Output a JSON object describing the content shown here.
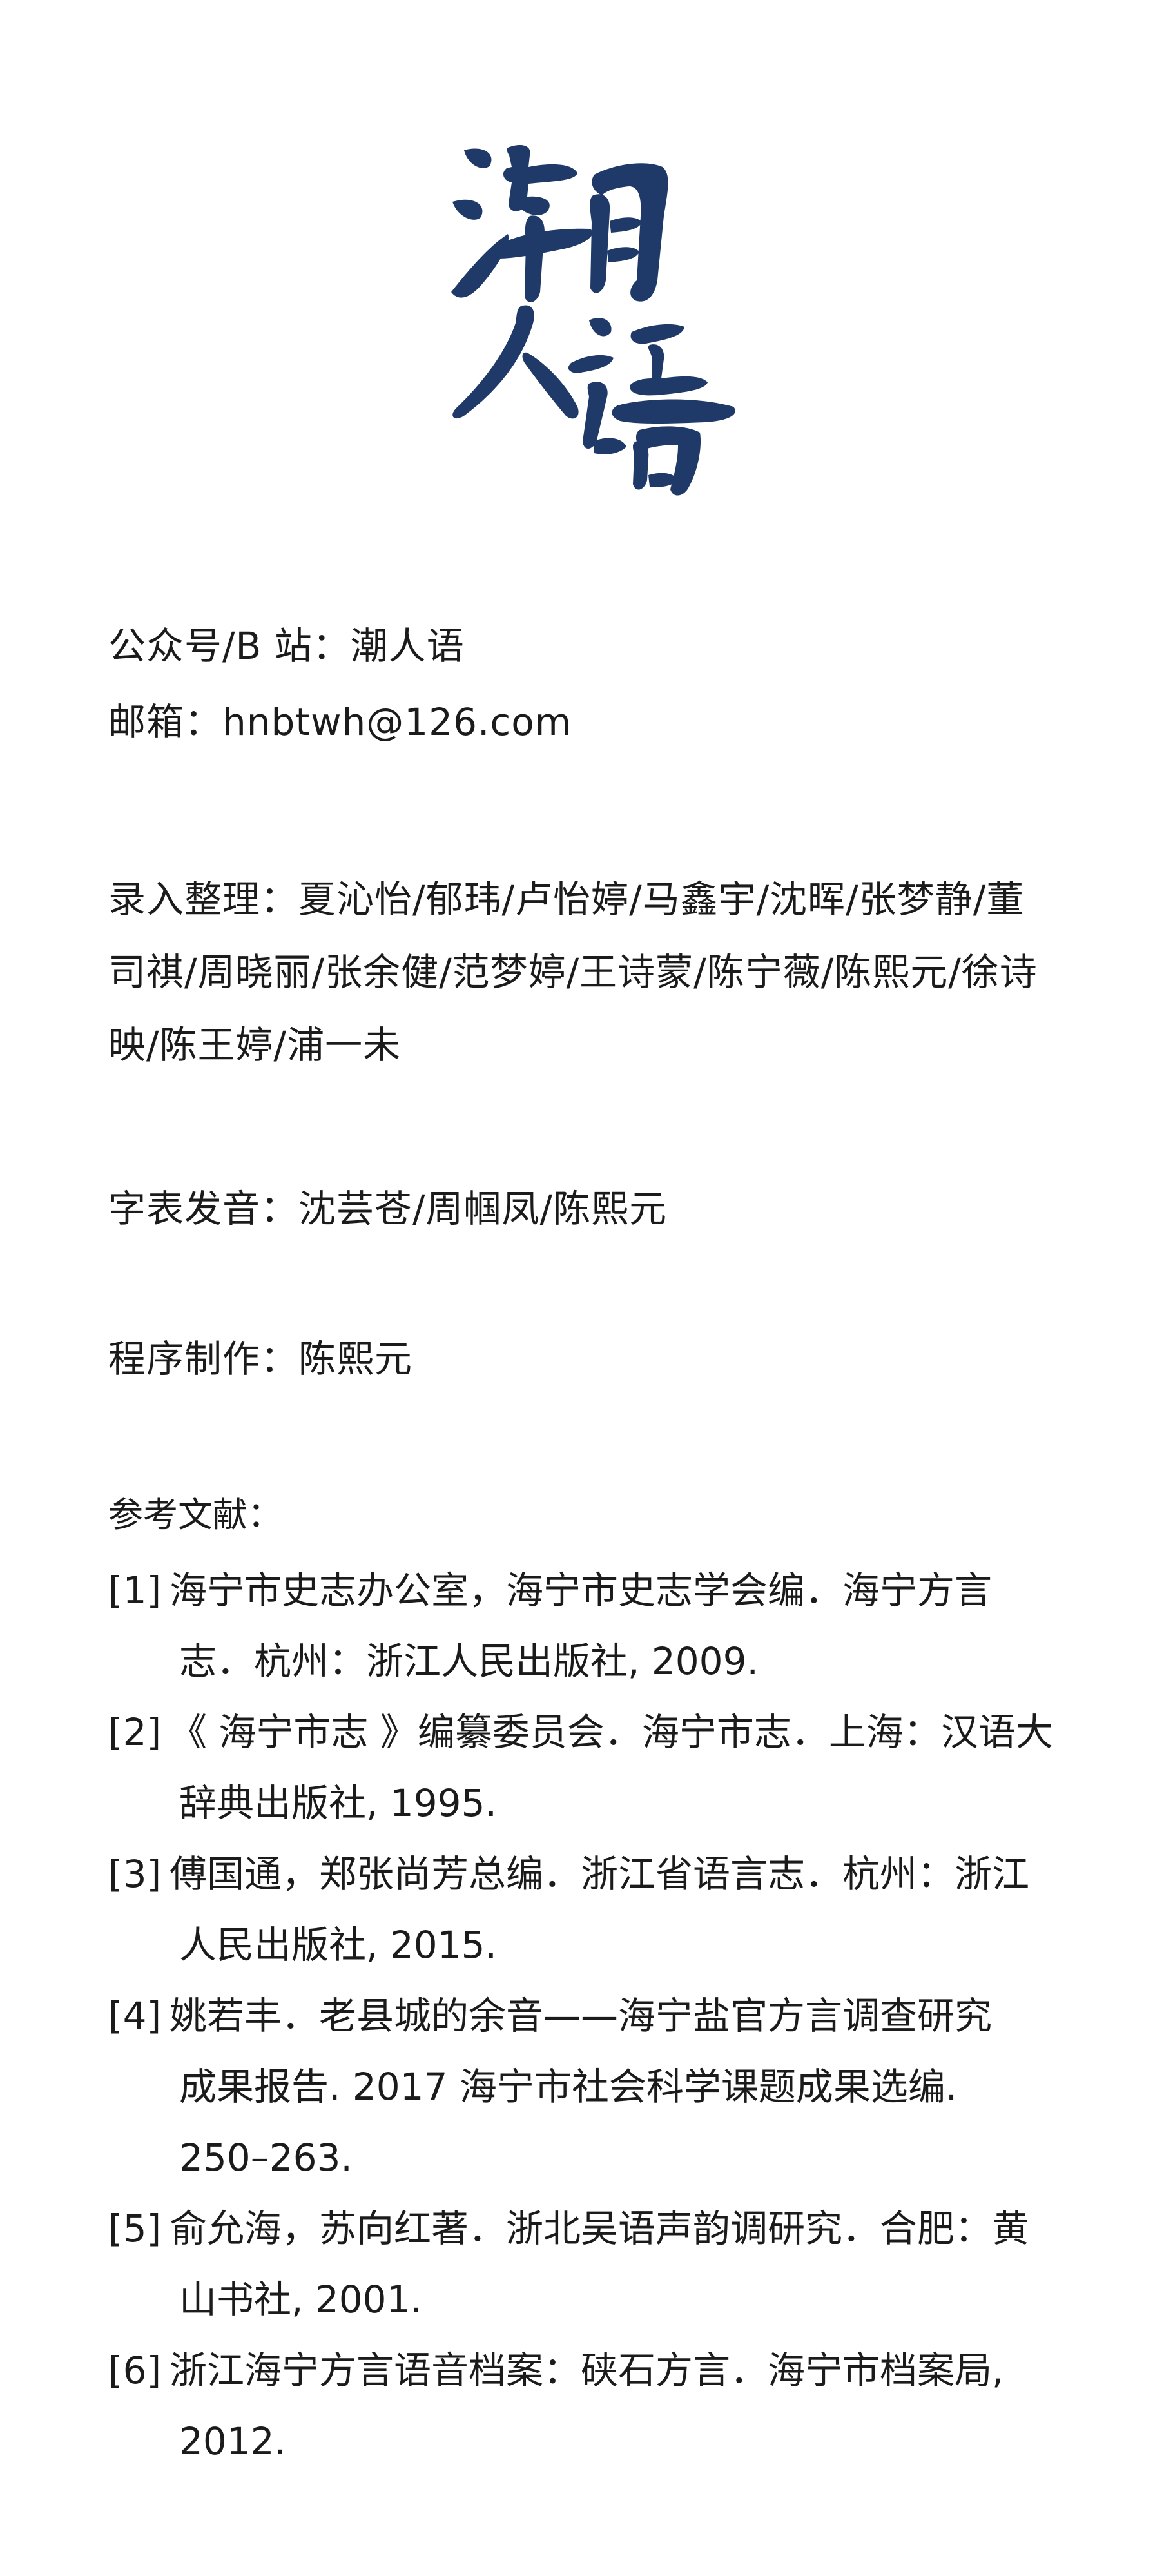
{
  "logo": {
    "characters": "潮人语",
    "color": "#1f3a68"
  },
  "info": {
    "account": "公众号/B 站：潮人语",
    "email": "邮箱：hnbtwh@126.com"
  },
  "credits": {
    "entry": [
      "录入整理：夏沁怡/郁玮/卢怡婷/马鑫宇/沈晖/张梦静/董",
      "司祺/周晓丽/张余健/范梦婷/王诗蒙/陈宁薇/陈熙元/徐诗",
      "映/陈王婷/浦一未"
    ],
    "pronunciation": "字表发音：沈芸苍/周帼凤/陈熙元",
    "program": "程序制作：陈熙元"
  },
  "references": {
    "title": "参考文献：",
    "items": [
      {
        "num": "[1]",
        "lines": [
          "海宁市史志办公室，海宁市史志学会编．海宁方言",
          "志．杭州：浙江人民出版社, 2009."
        ]
      },
      {
        "num": "[2]",
        "lines": [
          "《 海宁市志 》编纂委员会．海宁市志．上海：汉语大",
          "辞典出版社, 1995."
        ]
      },
      {
        "num": "[3]",
        "lines": [
          "傅国通，郑张尚芳总编．浙江省语言志．杭州：浙江",
          "人民出版社, 2015."
        ]
      },
      {
        "num": "[4]",
        "lines": [
          "姚若丰．老县城的余音——海宁盐官方言调查研究",
          "成果报告. 2017 海宁市社会科学课题成果选编.",
          "250–263."
        ]
      },
      {
        "num": "[5]",
        "lines": [
          "俞允海，苏向红著．浙北吴语声韵调研究．合肥：黄",
          "山书社, 2001."
        ]
      },
      {
        "num": "[6]",
        "lines": [
          "浙江海宁方言语音档案：硖石方言．海宁市档案局,",
          "2012."
        ]
      }
    ]
  }
}
